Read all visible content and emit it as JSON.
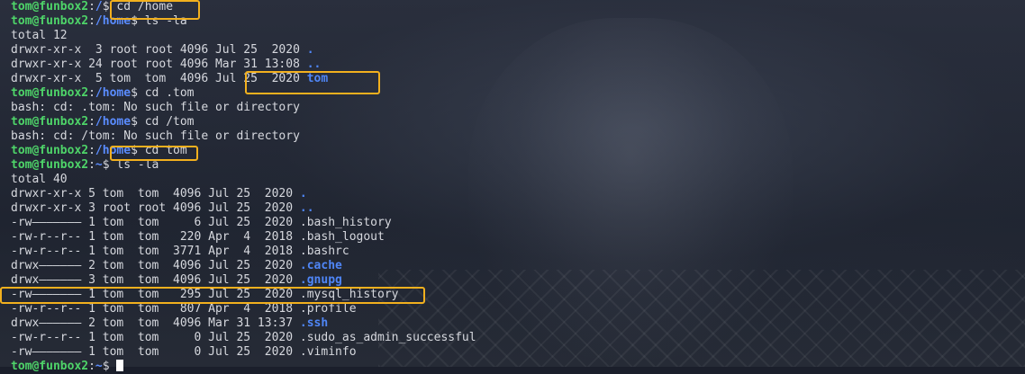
{
  "prompt": {
    "user_host": "tom@funbox2",
    "sep": ":",
    "home_symbol": "~"
  },
  "colors": {
    "user": "#4ed469",
    "path": "#5a8cff",
    "dir": "#4f86f7",
    "highlight": "#f2b01e",
    "background": "#1f2430"
  },
  "lines": [
    {
      "type": "prompt",
      "path": "/",
      "cmd": "cd /home"
    },
    {
      "type": "prompt",
      "path": "/home",
      "cmd": "ls -la"
    },
    {
      "type": "out",
      "text": "total 12"
    },
    {
      "type": "ls",
      "text": "drwxr-xr-x  3 root root 4096 Jul 25  2020 ",
      "name": ".",
      "isdir": true
    },
    {
      "type": "ls",
      "text": "drwxr-xr-x 24 root root 4096 Mar 31 13:08 ",
      "name": "..",
      "isdir": true
    },
    {
      "type": "ls",
      "text": "drwxr-xr-x  5 tom  tom  4096 Jul 25  2020 ",
      "name": "tom",
      "isdir": true
    },
    {
      "type": "prompt",
      "path": "/home",
      "cmd": "cd .tom"
    },
    {
      "type": "out",
      "text": "bash: cd: .tom: No such file or directory"
    },
    {
      "type": "prompt",
      "path": "/home",
      "cmd": "cd /tom"
    },
    {
      "type": "out",
      "text": "bash: cd: /tom: No such file or directory"
    },
    {
      "type": "prompt",
      "path": "/home",
      "cmd": "cd tom"
    },
    {
      "type": "prompt",
      "path": "~",
      "cmd": "ls -la"
    },
    {
      "type": "out",
      "text": "total 40"
    },
    {
      "type": "ls",
      "text": "drwxr-xr-x 5 tom  tom  4096 Jul 25  2020 ",
      "name": ".",
      "isdir": true
    },
    {
      "type": "ls",
      "text": "drwxr-xr-x 3 root root 4096 Jul 25  2020 ",
      "name": "..",
      "isdir": true
    },
    {
      "type": "ls",
      "text": "-rw——————— 1 tom  tom     6 Jul 25  2020 ",
      "name": ".bash_history",
      "isdir": false
    },
    {
      "type": "ls",
      "text": "-rw-r--r-- 1 tom  tom   220 Apr  4  2018 ",
      "name": ".bash_logout",
      "isdir": false
    },
    {
      "type": "ls",
      "text": "-rw-r--r-- 1 tom  tom  3771 Apr  4  2018 ",
      "name": ".bashrc",
      "isdir": false
    },
    {
      "type": "ls",
      "text": "drwx—————— 2 tom  tom  4096 Jul 25  2020 ",
      "name": ".cache",
      "isdir": true
    },
    {
      "type": "ls",
      "text": "drwx—————— 3 tom  tom  4096 Jul 25  2020 ",
      "name": ".gnupg",
      "isdir": true
    },
    {
      "type": "ls",
      "text": "-rw——————— 1 tom  tom   295 Jul 25  2020 ",
      "name": ".mysql_history",
      "isdir": false
    },
    {
      "type": "ls",
      "text": "-rw-r--r-- 1 tom  tom   807 Apr  4  2018 ",
      "name": ".profile",
      "isdir": false
    },
    {
      "type": "ls",
      "text": "drwx—————— 2 tom  tom  4096 Mar 31 13:37 ",
      "name": ".ssh",
      "isdir": true
    },
    {
      "type": "ls",
      "text": "-rw-r--r-- 1 tom  tom     0 Jul 25  2020 ",
      "name": ".sudo_as_admin_successful",
      "isdir": false
    },
    {
      "type": "ls",
      "text": "-rw——————— 1 tom  tom     0 Jul 25  2020 ",
      "name": ".viminfo",
      "isdir": false
    },
    {
      "type": "prompt",
      "path": "~",
      "cmd": "",
      "cursor": true
    }
  ]
}
